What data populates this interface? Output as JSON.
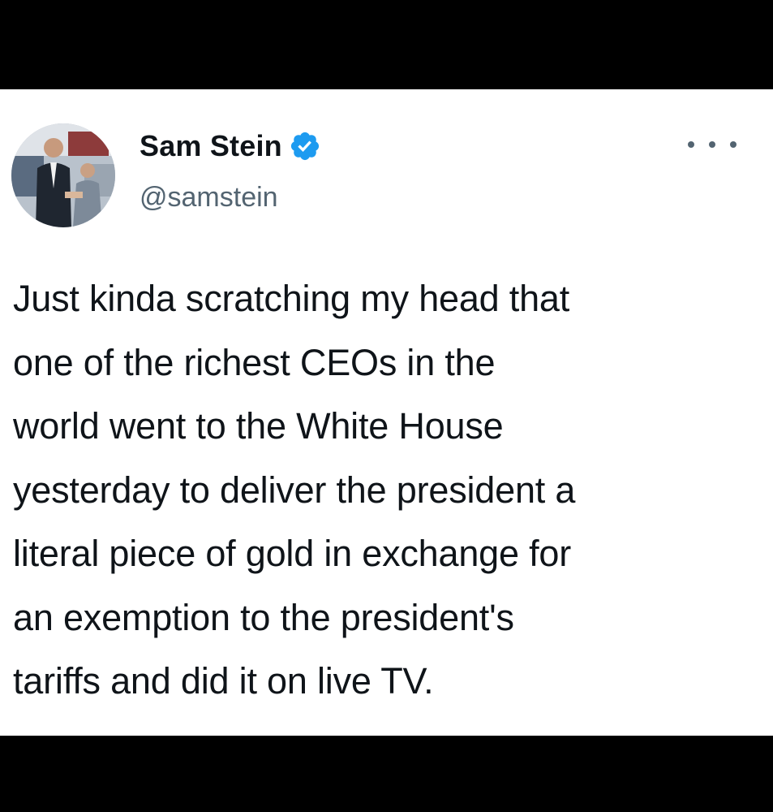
{
  "tweet": {
    "author": {
      "display_name": "Sam Stein",
      "handle": "@samstein",
      "verified_icon": "verified-badge-icon",
      "avatar": "profile-photo"
    },
    "more_icon": "more-options-icon",
    "text": "Just kinda scratching my head that\none of the richest CEOs in the\nworld went to the White House\nyesterday to deliver the president a\nliteral piece of gold in exchange for\nan exemption to the president's\ntariffs and did it on live TV."
  },
  "colors": {
    "background": "#ffffff",
    "frame": "#000000",
    "primary_text": "#0f1419",
    "secondary_text": "#536471",
    "verified_blue": "#1d9bf0"
  }
}
